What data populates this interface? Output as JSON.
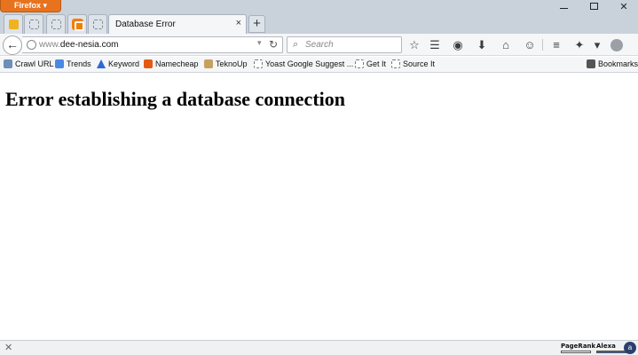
{
  "window": {
    "app_menu_label": "Firefox ▾",
    "minimize_glyph": "",
    "maximize_glyph": "",
    "close_glyph": "✕"
  },
  "tabs": {
    "active_tab_title": "Database Error",
    "active_tab_close": "×",
    "new_tab_label": "+"
  },
  "navbar": {
    "back_glyph": "←",
    "url_prefix": "www.",
    "url_host": "dee-nesia.com",
    "url_dropdown_glyph": "▾",
    "reload_glyph": "↻",
    "search_placeholder": "Search",
    "search_glyph": "⌕",
    "icons": {
      "star": "☆",
      "reading_list": "☰",
      "pocket": "◉",
      "download": "⬇",
      "home": "⌂",
      "hello": "☺",
      "menu": "≡",
      "addon": "✦",
      "addon_dropdown": "▾"
    }
  },
  "bookmarks": {
    "items": [
      {
        "label": "Crawl URL",
        "icon": "crawl-icon"
      },
      {
        "label": "Trends",
        "icon": "google-icon"
      },
      {
        "label": "Keyword",
        "icon": "adwords-icon"
      },
      {
        "label": "Namecheap",
        "icon": "namecheap-icon"
      },
      {
        "label": "TeknoUp",
        "icon": "teknoup-icon"
      },
      {
        "label": "Yoast Google Suggest ...",
        "icon": "blank-page-icon"
      },
      {
        "label": "Get It",
        "icon": "blank-page-icon"
      },
      {
        "label": "Source It",
        "icon": "blank-page-icon"
      }
    ],
    "bookmarks_menu_label": "Bookmarks"
  },
  "content": {
    "heading": "Error establishing a database connection"
  },
  "statusbar": {
    "close_glyph": "✕",
    "pagerank_label": "PageRank",
    "alexa_label": "Alexa",
    "addon_badge": "a"
  }
}
